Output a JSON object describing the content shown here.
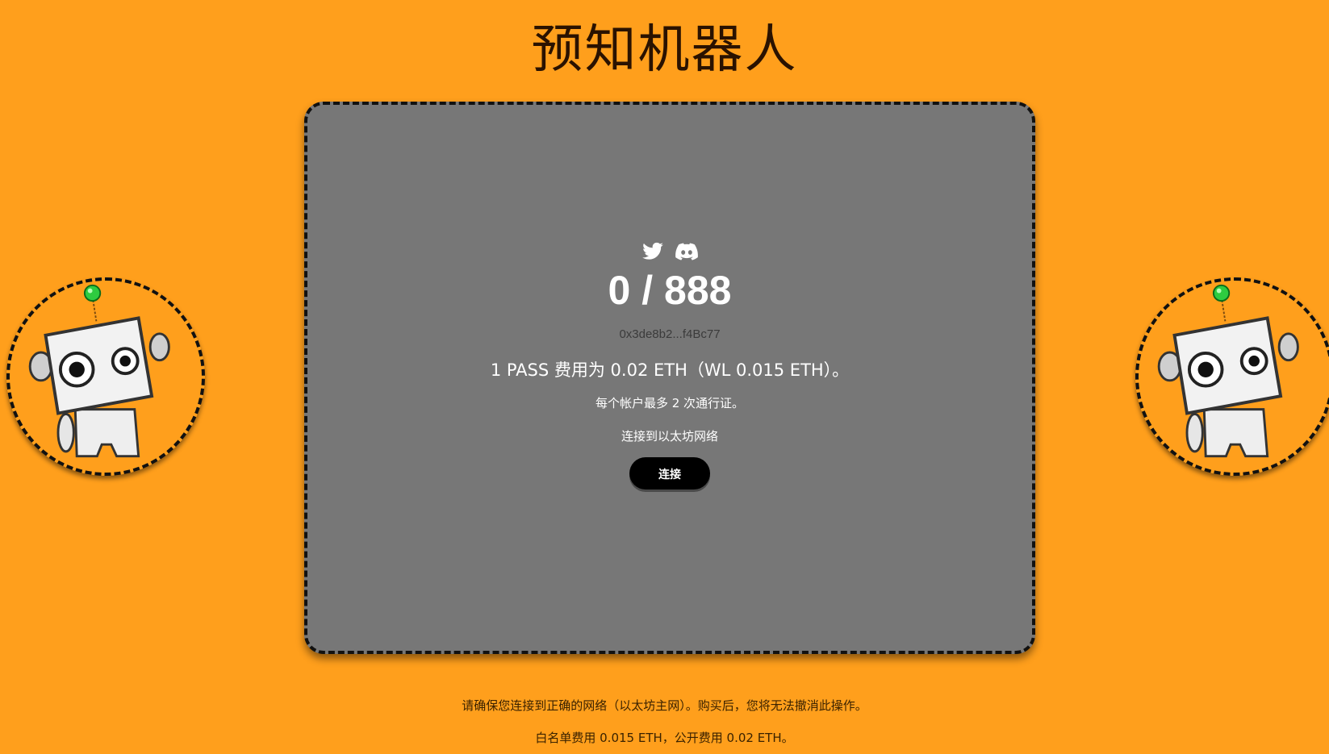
{
  "page": {
    "title": "预知机器人"
  },
  "card": {
    "socials": [
      {
        "icon": "twitter-icon"
      },
      {
        "icon": "discord-icon"
      }
    ],
    "counter": "0 / 888",
    "contract_address": "0x3de8b2...f4Bc77",
    "price_text": "1 PASS 费用为 0.02 ETH（WL 0.015 ETH）。",
    "limit_text": "每个帐户最多 2 次通行证。",
    "network_status": "连接到以太坊网络",
    "connect_button": "连接"
  },
  "footer": {
    "note_network": "请确保您连接到正确的网络（以太坊主网）。购买后，您将无法撤消此操作。",
    "note_fees": "白名单费用 0.015 ETH，公开费用 0.02 ETH。"
  },
  "colors": {
    "background": "#ff9f1c",
    "card": "#777777",
    "button": "#000000"
  }
}
